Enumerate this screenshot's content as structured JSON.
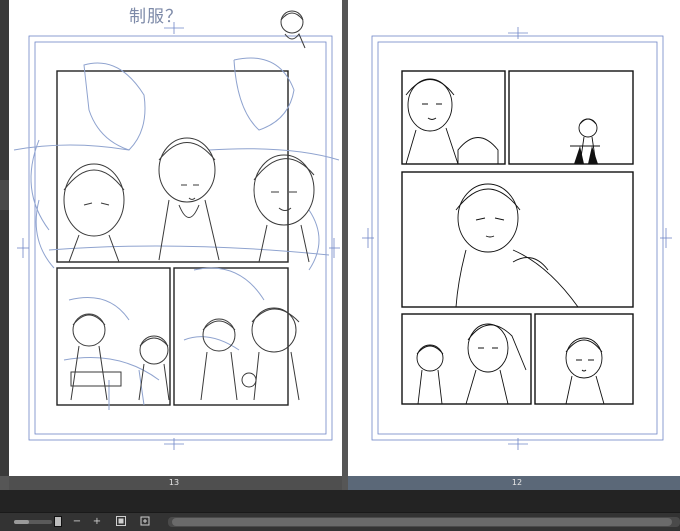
{
  "canvas": {
    "left_page": {
      "page_number": "13",
      "sketch_title": "制服？"
    },
    "right_page": {
      "page_number": "12"
    }
  },
  "status_bar": {
    "zoom_level": 0.4,
    "zoom_out_label": "−",
    "zoom_in_label": "+",
    "icons": [
      "zoom-out-icon",
      "zoom-in-icon",
      "fit-page-icon",
      "rotate-view-icon"
    ]
  },
  "colors": {
    "sketch_blue": "#8fa3cf",
    "pencil": "#3a3a3a",
    "ink": "#111111",
    "guide_blue": "#6f86c7",
    "active_page_label": "#5b6878"
  }
}
